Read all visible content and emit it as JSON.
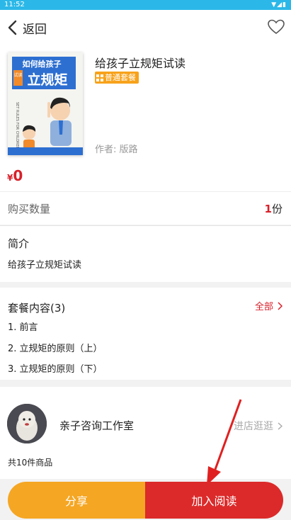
{
  "status_bar": {
    "time": "11:52",
    "icons": "▼◢▮"
  },
  "header": {
    "back_label": "返回"
  },
  "product": {
    "title": "给孩子立规矩试读",
    "badge": "普通套餐",
    "author": "作者: 版路",
    "price_symbol": "¥",
    "price": "0",
    "cover": {
      "line1": "如何给孩子",
      "line2": "立规矩",
      "tag": "试读",
      "subtitle_en": "SET RULES FOR CHILDREN"
    }
  },
  "quantity": {
    "label": "购买数量",
    "value": "1",
    "unit": "份"
  },
  "intro": {
    "title": "简介",
    "text": "给孩子立规矩试读"
  },
  "package": {
    "title": "套餐内容(3)",
    "all_label": "全部",
    "items": [
      "1. 前言",
      "2. 立规矩的原则（上）",
      "3. 立规矩的原则（下）"
    ]
  },
  "shop": {
    "name": "亲子咨询工作室",
    "visit_label": "进店逛逛",
    "count": "共10件商品"
  },
  "actions": {
    "share": "分享",
    "read": "加入阅读"
  },
  "colors": {
    "accent_red": "#dc2a2a",
    "accent_orange": "#f5a623",
    "status_bar": "#2bb8e8"
  }
}
